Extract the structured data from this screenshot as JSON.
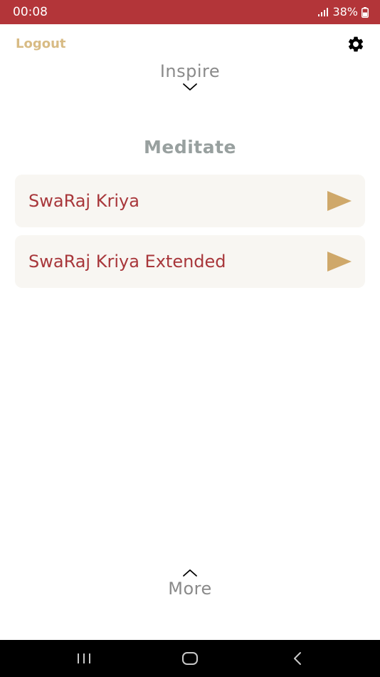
{
  "status_bar": {
    "time": "00:08",
    "battery": "38%",
    "background": "#b33539"
  },
  "header": {
    "logout_label": "Logout",
    "settings_icon": "gear-icon"
  },
  "inspire": {
    "label": "Inspire",
    "icon": "chevron-down-icon"
  },
  "meditate": {
    "heading": "Meditate",
    "tracks": [
      {
        "title": "SwaRaj Kriya",
        "icon": "play-icon"
      },
      {
        "title": "SwaRaj Kriya Extended",
        "icon": "play-icon"
      }
    ]
  },
  "more": {
    "label": "More",
    "icon": "chevron-up-icon"
  },
  "colors": {
    "accent_red": "#a8373b",
    "gold": "#d8bb84",
    "play_gold": "#cfa86a",
    "card_bg": "#f8f6f2",
    "muted_gray": "#8a8a8a"
  }
}
